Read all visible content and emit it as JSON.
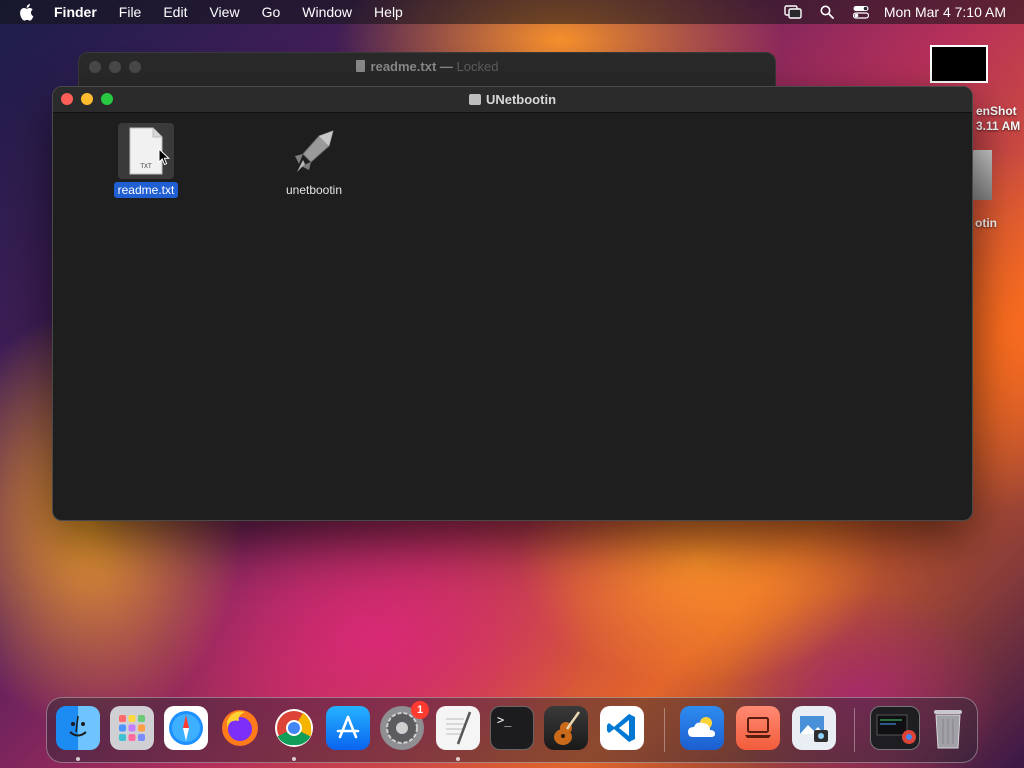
{
  "menubar": {
    "app_name": "Finder",
    "items": [
      "File",
      "Edit",
      "View",
      "Go",
      "Window",
      "Help"
    ],
    "clock": "Mon Mar 4  7:10 AM"
  },
  "desktop": {
    "screenshot_label_line1": "enShot",
    "screenshot_label_line2": "3.11 AM",
    "drive_label": "otin"
  },
  "back_window": {
    "title": "readme.txt",
    "separator": "—",
    "status": "Locked"
  },
  "finder": {
    "title": "UNetbootin",
    "files": [
      {
        "name": "readme.txt",
        "icon": "text-document-icon",
        "badge": "TXT",
        "selected": true
      },
      {
        "name": "unetbootin",
        "icon": "rocket-app-icon",
        "selected": false
      }
    ]
  },
  "dock": {
    "apps": [
      {
        "name": "Finder",
        "icon": "finder-icon",
        "running": true
      },
      {
        "name": "Launchpad",
        "icon": "launchpad-icon",
        "running": false
      },
      {
        "name": "Safari",
        "icon": "safari-icon",
        "running": false
      },
      {
        "name": "Firefox",
        "icon": "firefox-icon",
        "running": false
      },
      {
        "name": "Google Chrome",
        "icon": "chrome-icon",
        "running": true
      },
      {
        "name": "App Store",
        "icon": "app-store-icon",
        "running": false
      },
      {
        "name": "System Preferences",
        "icon": "system-preferences-icon",
        "running": false,
        "badge": "1"
      },
      {
        "name": "TextEdit",
        "icon": "textedit-icon",
        "running": true
      },
      {
        "name": "Terminal",
        "icon": "terminal-icon",
        "running": false
      },
      {
        "name": "GarageBand",
        "icon": "garageband-icon",
        "running": false
      },
      {
        "name": "Visual Studio Code",
        "icon": "vscode-icon",
        "running": false
      },
      {
        "name": "Weather",
        "icon": "weather-icon",
        "running": false
      },
      {
        "name": "Screen Sharing",
        "icon": "screen-sharing-icon",
        "running": false
      },
      {
        "name": "Preview",
        "icon": "preview-icon",
        "running": false
      },
      {
        "name": "Downloads",
        "icon": "downloads-stack-icon",
        "running": false
      },
      {
        "name": "Trash",
        "icon": "trash-icon",
        "running": false
      }
    ],
    "terminal_prompt": ">_"
  },
  "colors": {
    "selection_blue": "#1f5fd1",
    "close": "#ff5f57",
    "minimize": "#febc2e",
    "maximize": "#28c840",
    "badge_red": "#ff3b30"
  }
}
